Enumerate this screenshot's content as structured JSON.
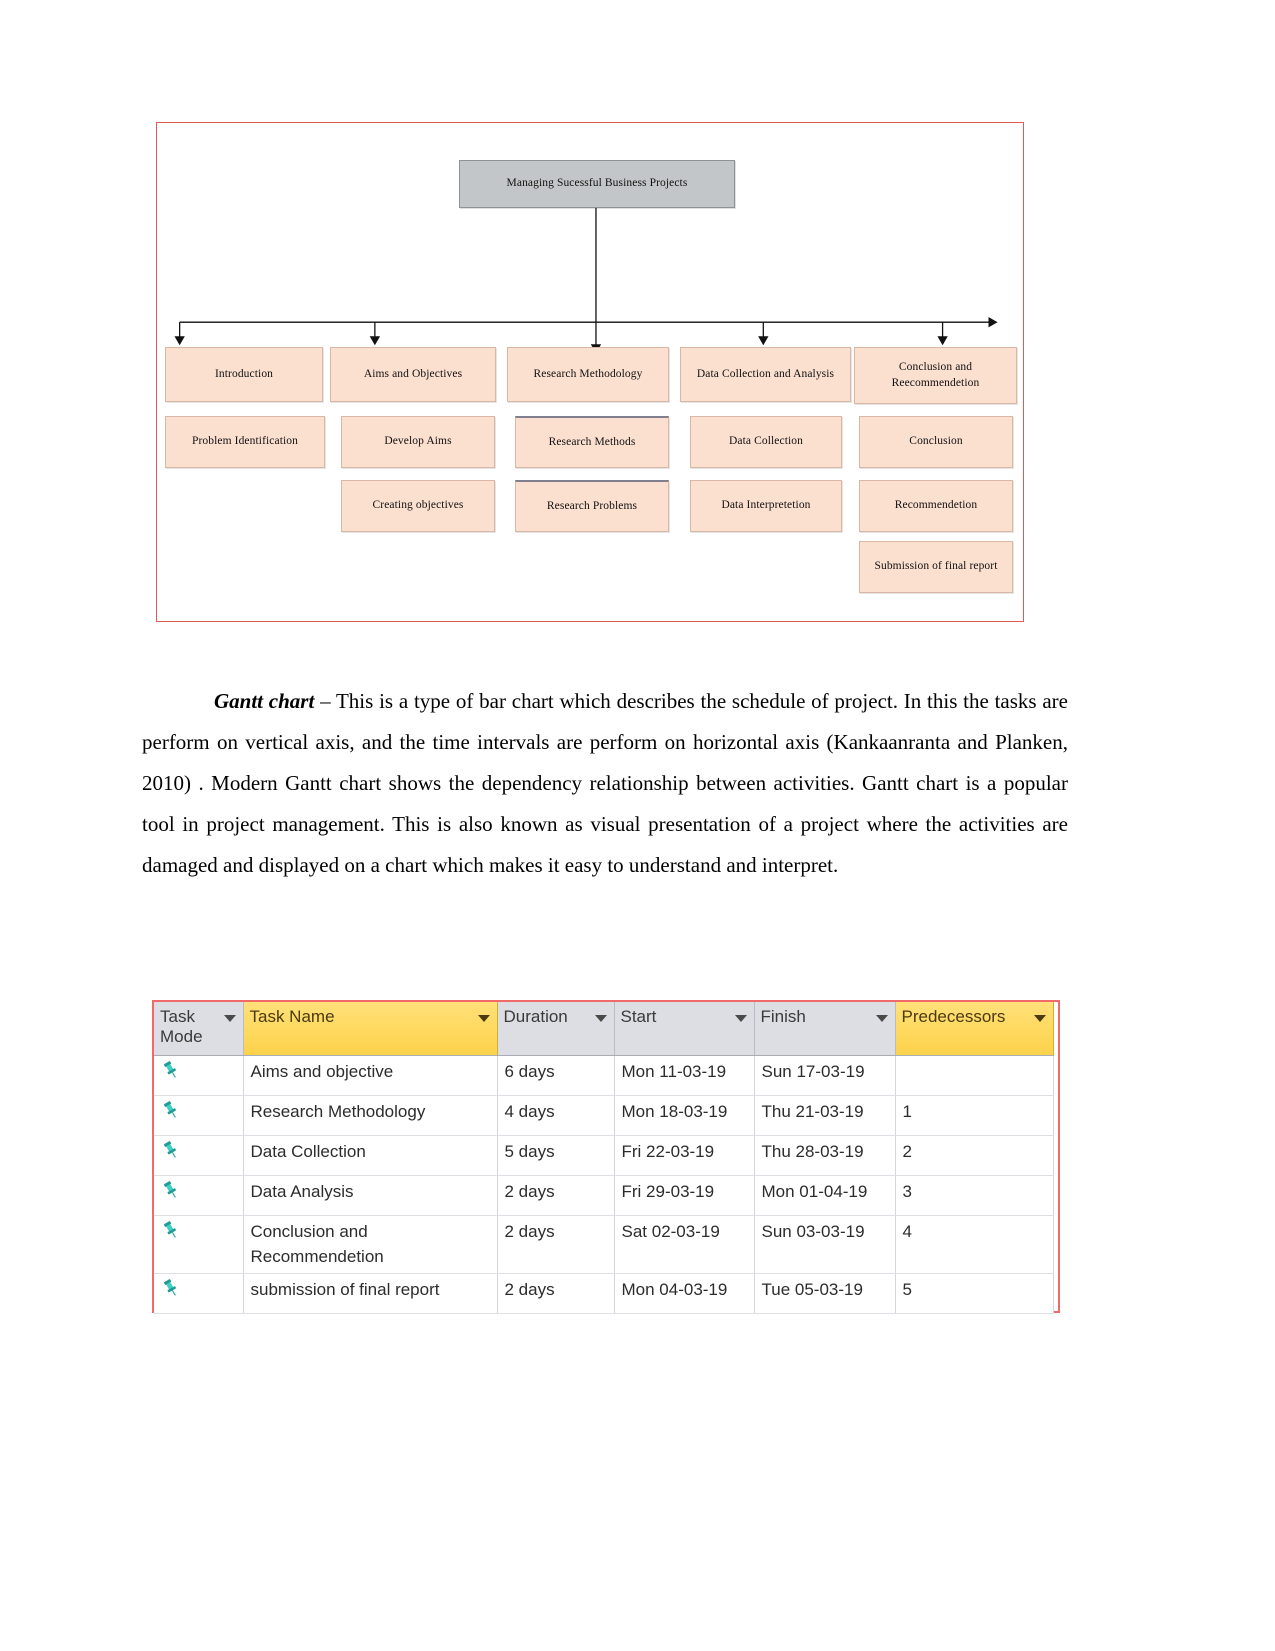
{
  "wbs": {
    "root": {
      "label": "Managing Sucessful Business Projects"
    },
    "level1": [
      {
        "label": "Introduction"
      },
      {
        "label": "Aims and Objectives"
      },
      {
        "label": "Research Methodology"
      },
      {
        "label": "Data Collection and Analysis"
      },
      {
        "label": "Conclusion and Reecommendetion"
      }
    ],
    "col1": [
      {
        "label": "Problem Identification"
      }
    ],
    "col2": [
      {
        "label": "Develop Aims"
      },
      {
        "label": "Creating objectives"
      }
    ],
    "col3": [
      {
        "label": "Research Methods"
      },
      {
        "label": "Research Problems"
      }
    ],
    "col4": [
      {
        "label": "Data Collection"
      },
      {
        "label": "Data Interpretetion"
      }
    ],
    "col5": [
      {
        "label": "Conclusion"
      },
      {
        "label": "Recommendetion"
      },
      {
        "label": "Submission of final report"
      }
    ]
  },
  "paragraph": {
    "lead": "Gantt chart",
    "body": " – This is a type of bar chart which describes the schedule of project. In this the tasks are perform on vertical axis, and the time intervals are perform on horizontal axis (Kankaanranta and Planken, 2010) . Modern Gantt chart shows the dependency relationship between activities. Gantt chart is a popular tool in project management. This is also known as visual presentation of a project where the activities are damaged and displayed on a chart which makes it easy to understand and interpret."
  },
  "gantt_table": {
    "columns": [
      {
        "key": "task_mode",
        "label": "Task Mode",
        "highlighted": false,
        "has_filter": true
      },
      {
        "key": "task_name",
        "label": "Task Name",
        "highlighted": true,
        "has_filter": true
      },
      {
        "key": "duration",
        "label": "Duration",
        "highlighted": false,
        "has_filter": true
      },
      {
        "key": "start",
        "label": "Start",
        "highlighted": false,
        "has_filter": true
      },
      {
        "key": "finish",
        "label": "Finish",
        "highlighted": false,
        "has_filter": true
      },
      {
        "key": "predecessors",
        "label": "Predecessors",
        "highlighted": true,
        "has_filter": true
      }
    ],
    "rows": [
      {
        "mode_icon": "pushpin-icon",
        "task_name": "Aims and objective",
        "duration": "6 days",
        "start": "Mon 11-03-19",
        "finish": "Sun 17-03-19",
        "predecessors": "",
        "selected": false
      },
      {
        "mode_icon": "pushpin-icon",
        "task_name": "Research Methodology",
        "duration": "4 days",
        "start": "Mon 18-03-19",
        "finish": "Thu 21-03-19",
        "predecessors": "1",
        "selected": false
      },
      {
        "mode_icon": "pushpin-icon",
        "task_name": "Data Collection",
        "duration": "5 days",
        "start": "Fri 22-03-19",
        "finish": "Thu 28-03-19",
        "predecessors": "2",
        "selected": false
      },
      {
        "mode_icon": "pushpin-icon",
        "task_name": "Data Analysis",
        "duration": "2 days",
        "start": "Fri 29-03-19",
        "finish": "Mon 01-04-19",
        "predecessors": "3",
        "selected": false
      },
      {
        "mode_icon": "pushpin-icon",
        "task_name": "Conclusion and Recommendetion",
        "duration": "2 days",
        "start": "Sat 02-03-19",
        "finish": "Sun 03-03-19",
        "predecessors": "4",
        "selected": false
      },
      {
        "mode_icon": "pushpin-icon",
        "task_name": "submission of final report",
        "duration": "2 days",
        "start": "Mon 04-03-19",
        "finish": "Tue 05-03-19",
        "predecessors": "5",
        "selected": true
      }
    ]
  },
  "colors": {
    "figure_border": "#e05a5a",
    "table_border": "#f06a6a",
    "header_grey": "#dcdee3",
    "header_yellow": "#ffd95e",
    "node_peach": "#fbe0d0",
    "node_grey": "#c3c6c8",
    "selection_blue": "#dce9f7",
    "pin_teal": "#2fb7ae"
  }
}
